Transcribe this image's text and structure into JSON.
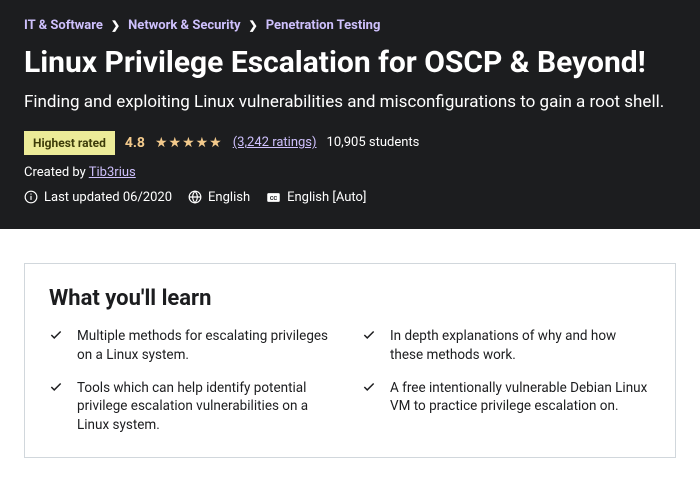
{
  "breadcrumb": {
    "items": [
      "IT & Software",
      "Network & Security",
      "Penetration Testing"
    ]
  },
  "course": {
    "title": "Linux Privilege Escalation for OSCP & Beyond!",
    "subtitle": "Finding and exploiting Linux vulnerabilities and misconfigurations to gain a root shell.",
    "badge": "Highest rated",
    "rating": "4.8",
    "ratings_link": "(3,242 ratings)",
    "students": "10,905 students",
    "created_by_label": "Created by ",
    "author": "Tib3rius ",
    "last_updated": "Last updated 06/2020",
    "language": "English",
    "captions": "English [Auto]"
  },
  "learn": {
    "heading": "What you'll learn",
    "items": [
      "Multiple methods for escalating privileges on a Linux system.",
      "In depth explanations of why and how these methods work.",
      "Tools which can help identify potential privilege escalation vulnerabilities on a Linux system.",
      "A free intentionally vulnerable Debian Linux VM to practice privilege escalation on."
    ]
  }
}
